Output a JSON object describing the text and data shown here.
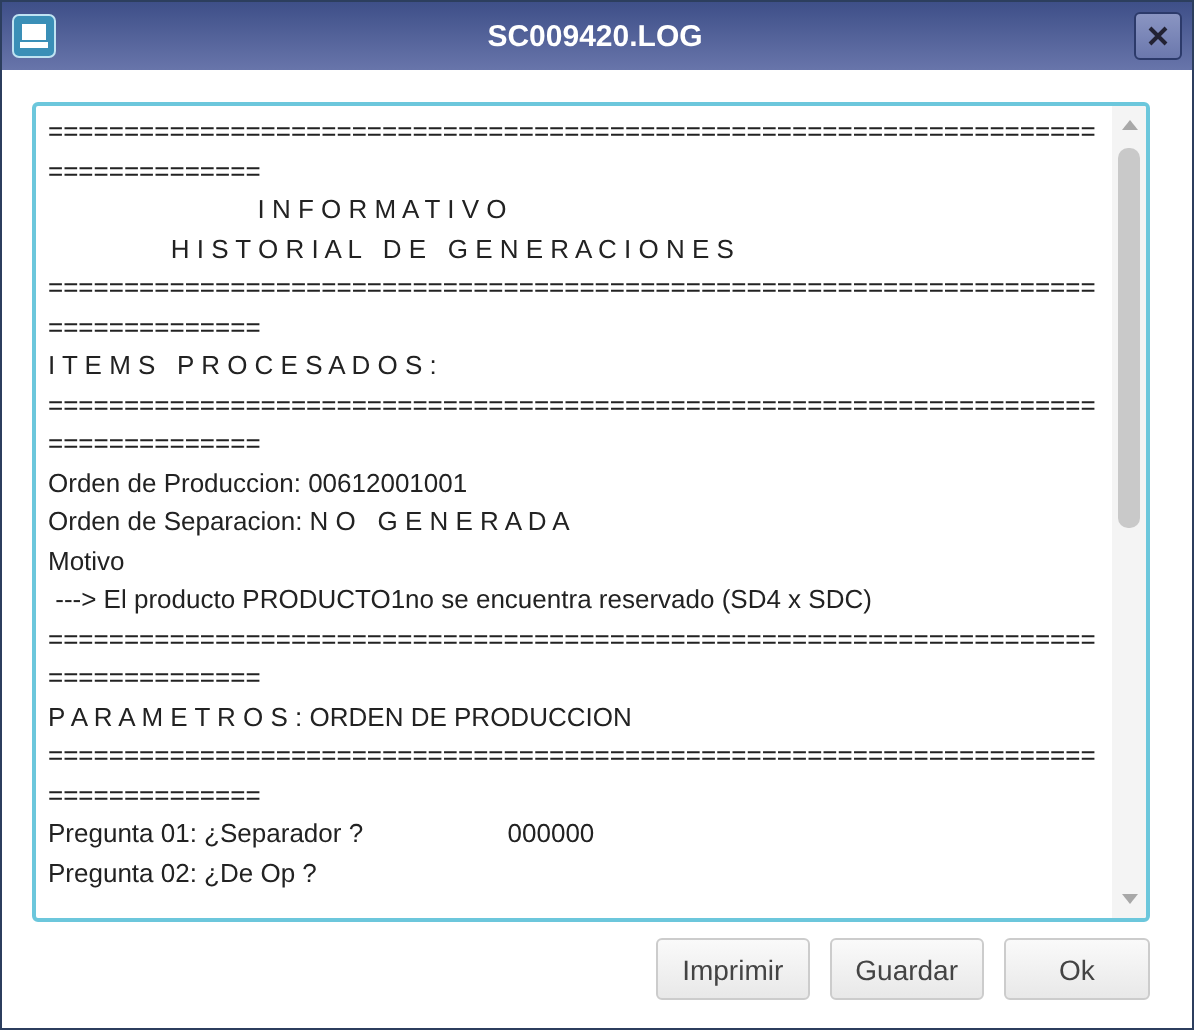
{
  "window": {
    "title": "SC009420.LOG"
  },
  "log_lines": [
    "=====================================================================",
    "==============",
    "                             I N F O R M A T I V O",
    "                 H I S T O R I A L   D E   G E N E R A C I O N E S",
    "=====================================================================",
    "==============",
    "I T E M S   P R O C E S A D O S :",
    "=====================================================================",
    "==============",
    "Orden de Produccion: 00612001001",
    "Orden de Separacion: N O   G E N E R A D A",
    "Motivo",
    " ---> El producto PRODUCTO1no se encuentra reservado (SD4 x SDC)",
    "=====================================================================",
    "==============",
    "P A R A M E T R O S : ORDEN DE PRODUCCION",
    "=====================================================================",
    "==============",
    "Pregunta 01: ¿Separador ?                    000000",
    "Pregunta 02: ¿De Op ?"
  ],
  "buttons": [
    "Imprimir",
    "Guardar",
    "Ok"
  ]
}
